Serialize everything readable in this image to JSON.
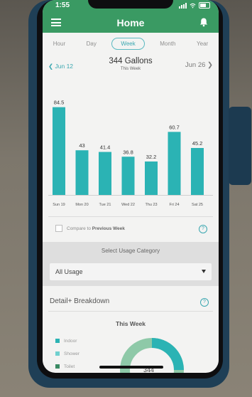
{
  "status_bar": {
    "time": "1:55"
  },
  "header": {
    "title": "Home"
  },
  "tabs": [
    {
      "label": "Hour",
      "active": false
    },
    {
      "label": "Day",
      "active": false
    },
    {
      "label": "Week",
      "active": true
    },
    {
      "label": "Month",
      "active": false
    },
    {
      "label": "Year",
      "active": false
    }
  ],
  "date_nav": {
    "prev_label": "Jun 12",
    "next_label": "Jun 26",
    "total": "344 Gallons",
    "period": "This Week"
  },
  "chart_data": {
    "type": "bar",
    "categories": [
      "Sun 19",
      "Mon 20",
      "Tue 21",
      "Wed 22",
      "Thu 23",
      "Fri 24",
      "Sat 25"
    ],
    "values": [
      84.5,
      43,
      41.4,
      36.8,
      32.2,
      60.7,
      45.2
    ],
    "value_labels": [
      "84.5",
      "43",
      "41.4",
      "36.8",
      "32.2",
      "60.7",
      "45.2"
    ],
    "bar_color": "#2bb3b4",
    "ylim": [
      0,
      100
    ]
  },
  "compare": {
    "prefix": "Compare to ",
    "emphasis": "Previous Week"
  },
  "usage": {
    "section_label": "Select Usage Category",
    "selected": "All Usage"
  },
  "detail": {
    "heading": "Detail+ Breakdown",
    "week_heading": "This Week",
    "legend": [
      {
        "label": "Indoor",
        "color": "#2bb3b4"
      },
      {
        "label": "Shower",
        "color": "#6fd0cf"
      },
      {
        "label": "Toilet",
        "color": "#3a8a63"
      }
    ],
    "donut_center": "344"
  },
  "colors": {
    "accent": "#3a9a63",
    "teal": "#3aa7b0"
  }
}
